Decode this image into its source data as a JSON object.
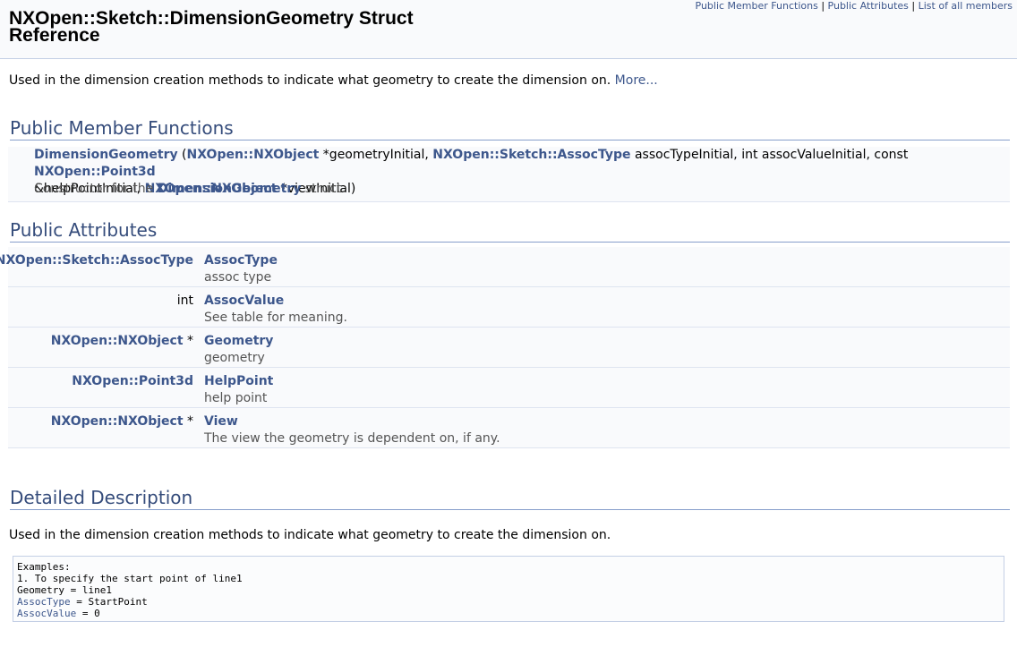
{
  "summary": {
    "public_member_functions": "Public Member Functions",
    "separator": "|",
    "public_attributes": "Public Attributes",
    "list_all_members": "List of all members"
  },
  "title": "NXOpen::Sketch::DimensionGeometry Struct Reference",
  "intro": {
    "text": "Used in the dimension creation methods to indicate what geometry to create the dimension on.",
    "more_link": "More..."
  },
  "member_functions": {
    "heading": "Public Member Functions",
    "signature": {
      "name": "DimensionGeometry",
      "open_paren": " (",
      "type1": "NXOpen::NXObject",
      "param1": " *geometryInitial, ",
      "type2": "NXOpen::Sketch::AssocType",
      "param2": " assocTypeInitial, int assocValueInitial, const ",
      "type3": "NXOpen::Point3d",
      "param3": " &helpPointInitial, ",
      "type4": "NXOpen::NXObject",
      "param4": " *viewInitial)"
    },
    "description_prefix": "Constructor for the ",
    "description_link": "DimensionGeometry",
    "description_suffix": " struct."
  },
  "attributes": {
    "heading": "Public Attributes",
    "rows": [
      {
        "type_link": "NXOpen::Sketch::AssocType",
        "type_suffix": "",
        "name": "AssocType",
        "desc": "assoc type"
      },
      {
        "type_plain": "int",
        "name": "AssocValue",
        "desc": "See table for meaning."
      },
      {
        "type_link": "NXOpen::NXObject",
        "type_suffix": " *",
        "name": "Geometry",
        "desc": "geometry"
      },
      {
        "type_link": "NXOpen::Point3d",
        "type_suffix": "",
        "name": "HelpPoint",
        "desc": "help point"
      },
      {
        "type_link": "NXOpen::NXObject",
        "type_suffix": " *",
        "name": "View",
        "desc": "The view the geometry is dependent on, if any."
      }
    ]
  },
  "detailed": {
    "heading": "Detailed Description",
    "text": "Used in the dimension creation methods to indicate what geometry to create the dimension on.",
    "code": {
      "line1": "Examples:",
      "line2": "1. To specify the start point of line1",
      "line3": "Geometry = line1",
      "line4_link": "AssocType",
      "line4_rest": " = StartPoint",
      "line5_link": "AssocValue",
      "line5_rest": " = 0"
    }
  },
  "colors": {
    "link": "#3d578c",
    "heading": "#354c7b",
    "row_background": "#f9fafc",
    "border": "#c4cfe5"
  }
}
